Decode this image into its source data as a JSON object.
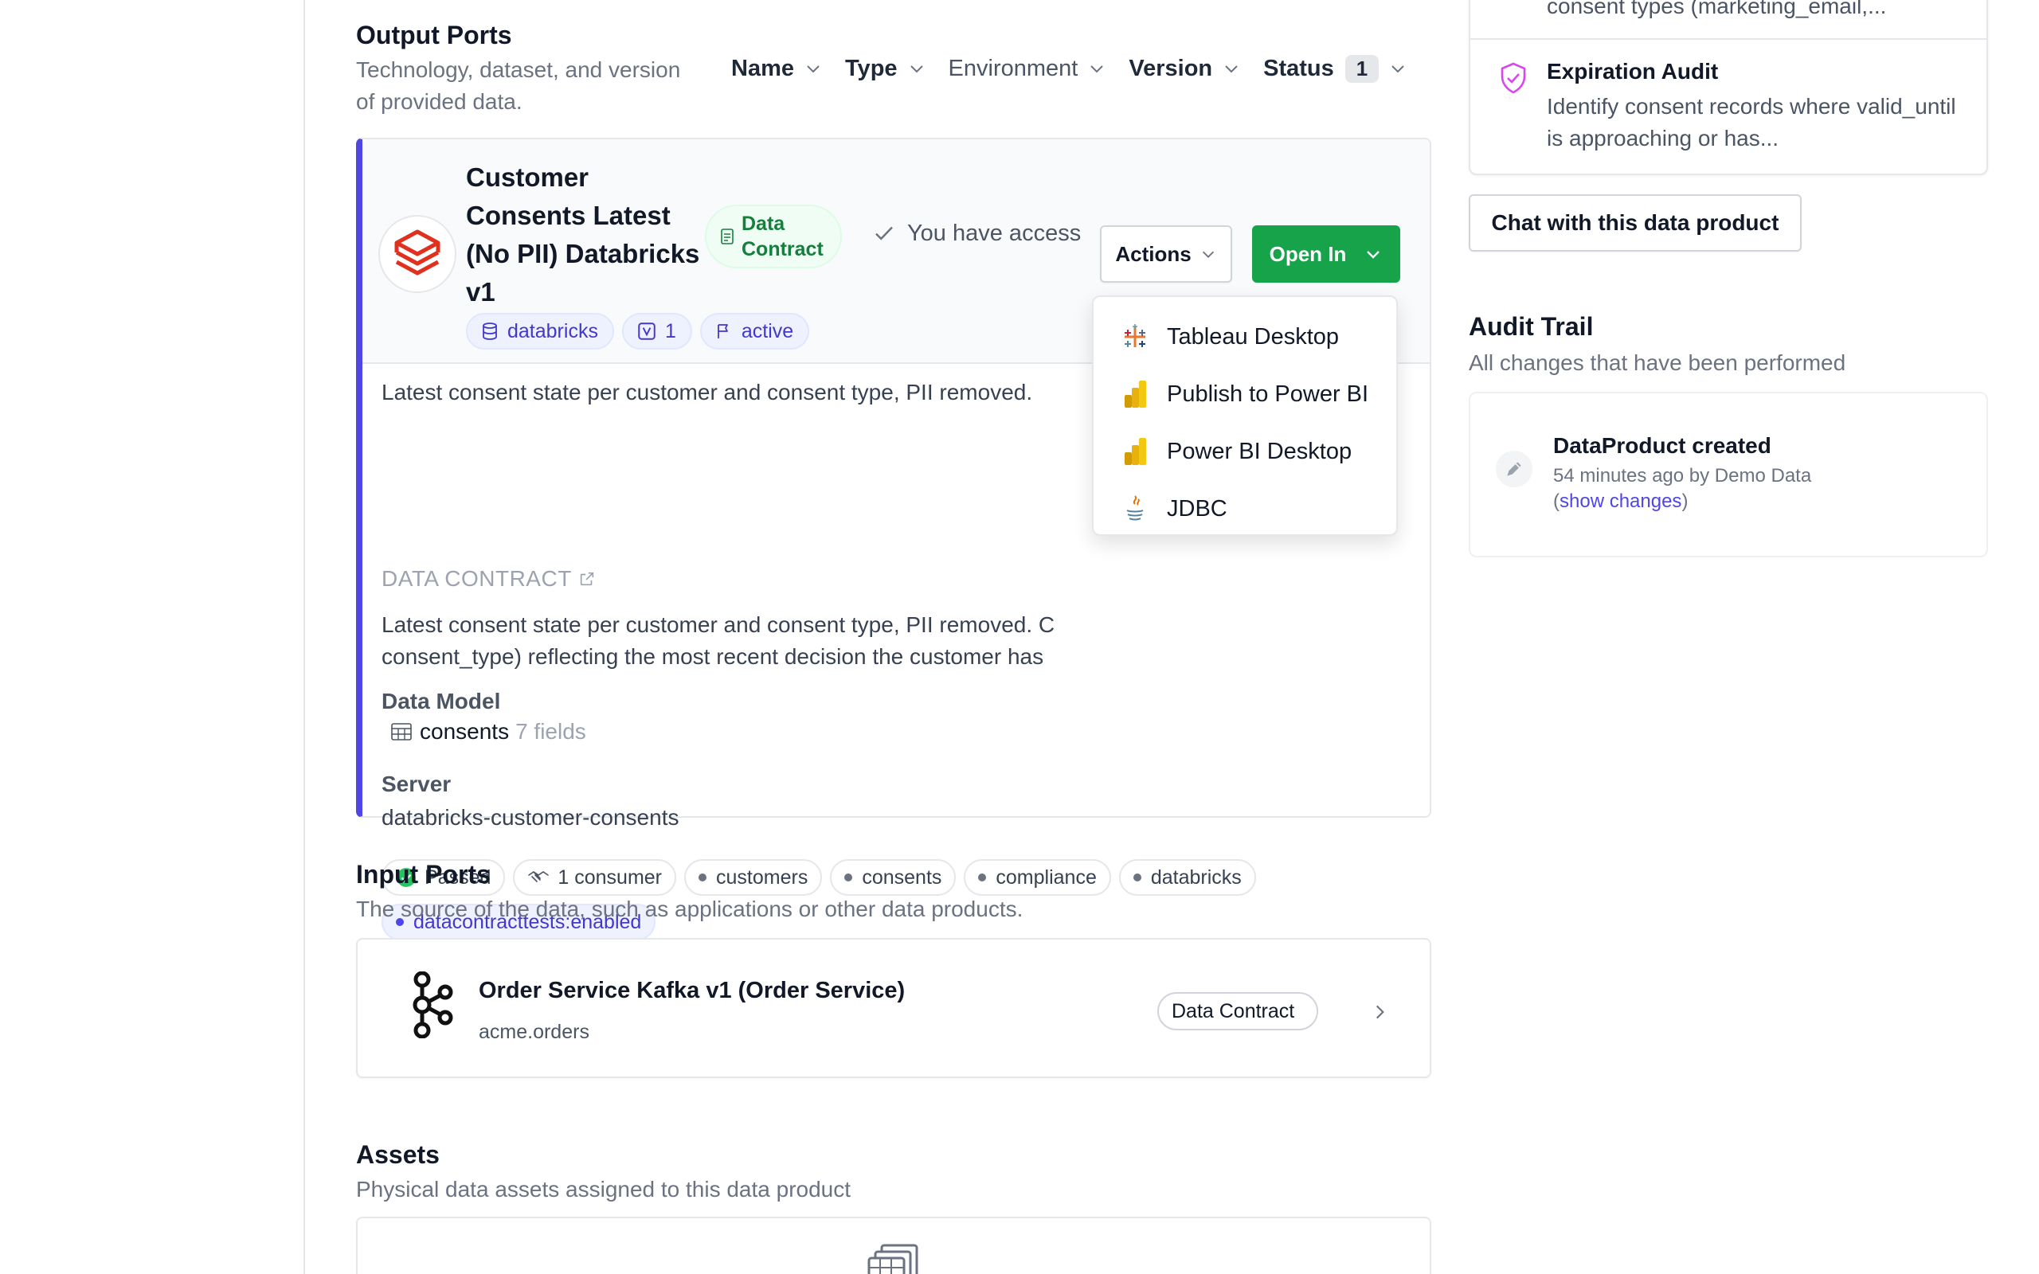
{
  "output_ports": {
    "title": "Output Ports",
    "description_line1": "Technology, dataset, and version",
    "description_line2": "of provided data.",
    "filters": {
      "name": "Name",
      "type": "Type",
      "environment": "Environment",
      "version": "Version",
      "status": "Status",
      "status_count": "1"
    },
    "port": {
      "title": "Customer Consents Latest (No PII) Databricks v1",
      "data_contract_badge": "Data Contract",
      "access_text": "You have access",
      "actions_label": "Actions",
      "open_in_label": "Open In",
      "technology": "databricks",
      "version": "1",
      "status": "active",
      "description": "Latest consent state per customer and consent type, PII removed.",
      "data_contract_label": "DATA CONTRACT",
      "contract_desc_line1": "Latest consent state per customer and consent type, PII removed. C",
      "contract_desc_line2": "consent_type) reflecting the most recent decision the customer has",
      "data_model_label": "Data Model",
      "model_name": "consents",
      "model_fields": "7 fields",
      "server_label": "Server",
      "server_value": "databricks-customer-consents",
      "tags": {
        "passed": "Passed",
        "consumers": "1 consumer",
        "t1": "customers",
        "t2": "consents",
        "t3": "compliance",
        "t4": "databricks",
        "t5": "datacontracttests:enabled"
      }
    },
    "open_in_menu": {
      "tableau": "Tableau Desktop",
      "publish_powerbi": "Publish to Power BI",
      "powerbi_desktop": "Power BI Desktop",
      "jdbc": "JDBC"
    }
  },
  "input_ports": {
    "title": "Input Ports",
    "description": "The source of the data, such as applications or other data products.",
    "item_title": "Order Service Kafka v1 (Order Service)",
    "item_subtitle": "acme.orders",
    "item_badge": "Data Contract"
  },
  "assets": {
    "title": "Assets",
    "description": "Physical data assets assigned to this data product"
  },
  "right": {
    "top_item_text": "consent types (marketing_email,...",
    "expiration_title": "Expiration Audit",
    "expiration_desc": "Identify consent records where valid_until is approaching or has...",
    "chat_button": "Chat with this data product",
    "audit_title": "Audit Trail",
    "audit_desc": "All changes that have been performed",
    "audit_entry_title": "DataProduct created",
    "audit_entry_meta": "54 minutes ago by Demo Data",
    "audit_show_changes": "show changes"
  },
  "colors": {
    "accent": "#4f46e5",
    "success": "#16a34a"
  }
}
